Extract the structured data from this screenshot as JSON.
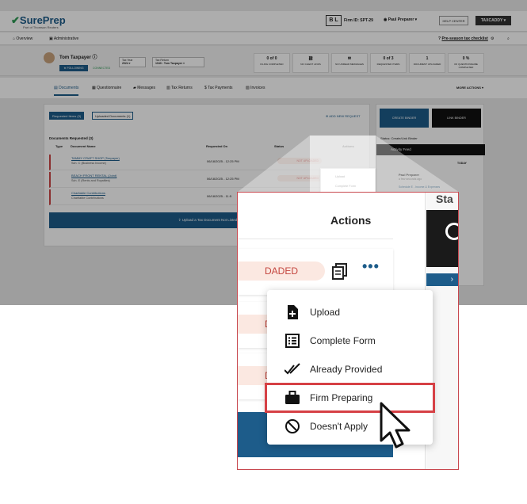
{
  "topbar": {
    "logo": "SurePrep",
    "logo_sub": "Part of Thomson Reuters",
    "firm_badge": "B L",
    "firm_id": "Firm ID: SPT-29",
    "user": "Paul Preparer",
    "help": "HELP CENTER",
    "taxcaddy": "TAXCADDY"
  },
  "nav": {
    "overview": "Overview",
    "administrative": "Administrative",
    "checklist": "Pre-season tax checklist"
  },
  "client": {
    "name": "Tom Taxpayer",
    "following": "FOLLOWING",
    "connected": "CONNECTED",
    "tax_year_label": "Tax Year",
    "tax_year": "2024",
    "tax_return_label": "Tax Return",
    "tax_return": "1040 : Tom Taxpayer"
  },
  "stats": [
    {
      "value": "0 of 0",
      "label": "FILING COMPLETED"
    },
    {
      "value": "",
      "label": "NO CLIENT LINKS"
    },
    {
      "value": "",
      "label": "NO UNREAD MESSAGES"
    },
    {
      "value": "0 of 3",
      "label": "REQUESTED ITEMS"
    },
    {
      "value": "1",
      "label": "DOCUMENT UPLOADED"
    },
    {
      "value": "0 %",
      "label": "OF QUESTIONNAIRE COMPLETED"
    }
  ],
  "tabs": [
    "Documents",
    "Questionnaire",
    "Messages",
    "Tax Returns",
    "Tax Payments",
    "Invoices"
  ],
  "more_actions": "MORE ACTIONS",
  "documents": {
    "seg_requested": "Requested Items (3)",
    "seg_uploaded": "Uploaded Documents (1)",
    "add_new": "ADD NEW REQUEST",
    "requested_title": "Documents Requested (3)",
    "col_type": "Type",
    "col_name": "Document Name",
    "col_requested": "Requested On",
    "col_status": "Status",
    "col_actions": "Actions",
    "rows": [
      {
        "name": "TAMMY CRAFT SHOP (Taxpayer)",
        "sub": "Sch. C (Business Income)",
        "date": "06/18/2025 - 12:25 PM",
        "status": "NOT UPLOADED"
      },
      {
        "name": "BEACH FRONT RENTAL (Joint)",
        "sub": "Sch. E (Rents and Royalties)",
        "date": "06/18/2025 - 12:25 PM",
        "status": "NOT UPLOADED"
      },
      {
        "name": "Charitable Contributions",
        "sub": "Charitable Contributions",
        "date": "06/18/2025 - 11:5",
        "status": "NOT UPLOADED"
      }
    ],
    "upload_bar": "Upload a Tax Document Not Listed"
  },
  "small_menu": [
    "Upload",
    "Complete Form"
  ],
  "binder": {
    "create": "CREATE BINDER",
    "link": "LINK BINDER",
    "status": "Status: Create/Link Binder",
    "feed_title": "Activity Feed",
    "today": "TODAY",
    "feed_name": "Paul Preparer",
    "feed_meta": "a few seconds ago",
    "feed_action": "Schedule E - Income & Expenses"
  },
  "zoom": {
    "actions_heading": "Actions",
    "status_fragment": "DADED",
    "status_fragment_plain": "DED",
    "right_stub": "Sta",
    "menu": [
      {
        "label": "Upload",
        "icon": "upload-file-icon"
      },
      {
        "label": "Complete Form",
        "icon": "form-list-icon"
      },
      {
        "label": "Already Provided",
        "icon": "double-check-icon"
      },
      {
        "label": "Firm Preparing",
        "icon": "briefcase-icon",
        "highlighted": true
      },
      {
        "label": "Doesn't Apply",
        "icon": "prohibited-icon"
      }
    ],
    "highlight_color": "#d64045"
  },
  "colors": {
    "brand": "#1d5c8a",
    "danger": "#c4463f",
    "success": "#2e9a55"
  }
}
